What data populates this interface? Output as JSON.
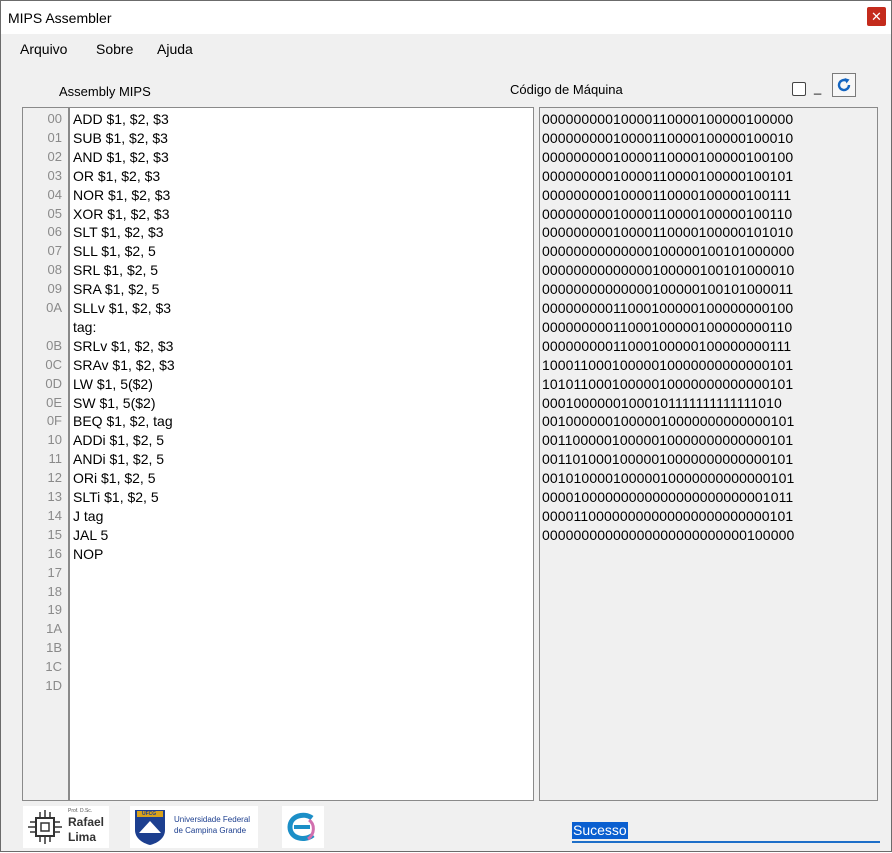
{
  "window": {
    "title": "MIPS Assembler",
    "close_label": "✕"
  },
  "menu": [
    "Arquivo",
    "Sobre",
    "Ajuda"
  ],
  "labels": {
    "assembly": "Assembly MIPS",
    "machine": "Código de Máquina",
    "dash": "_"
  },
  "line_numbers": [
    "00",
    "01",
    "02",
    "03",
    "04",
    "05",
    "06",
    "07",
    "08",
    "09",
    "0A",
    "",
    "0B",
    "0C",
    "0D",
    "0E",
    "0F",
    "10",
    "11",
    "12",
    "13",
    "14",
    "15",
    "16",
    "17",
    "18",
    "19",
    "1A",
    "1B",
    "1C",
    "1D"
  ],
  "code": [
    "ADD $1, $2, $3",
    "SUB $1, $2, $3",
    "AND $1, $2, $3",
    "OR $1, $2, $3",
    "NOR $1, $2, $3",
    "XOR $1, $2, $3",
    "SLT $1, $2, $3",
    "SLL $1, $2, 5",
    "SRL $1, $2, 5",
    "SRA $1, $2, 5",
    "SLLv $1, $2, $3",
    "tag:",
    "SRLv $1, $2, $3",
    "SRAv $1, $2, $3",
    "LW $1, 5($2)",
    "SW $1, 5($2)",
    "BEQ $1, $2, tag",
    "ADDi $1, $2, 5",
    "ANDi $1, $2, 5",
    "ORi $1, $2, 5",
    "SLTi $1, $2, 5",
    "J tag",
    "JAL 5",
    "NOP"
  ],
  "machine_code": [
    "00000000010000110000100000100000",
    "00000000010000110000100000100010",
    "00000000010000110000100000100100",
    "00000000010000110000100000100101",
    "00000000010000110000100000100111",
    "00000000010000110000100000100110",
    "00000000010000110000100000101010",
    "00000000000000100000100101000000",
    "00000000000000100000100101000010",
    "00000000000000100000100101000011",
    "00000000011000100000100000000100",
    "00000000011000100000100000000110",
    "00000000011000100000100000000111",
    "10001100010000010000000000000101",
    "10101100010000010000000000000101",
    "00010000001000101111111111111010",
    "00100000010000010000000000000101",
    "00110000010000010000000000000101",
    "00110100010000010000000000000101",
    "00101000010000010000000000000101",
    "00001000000000000000000000001011",
    "00001100000000000000000000000101",
    "00000000000000000000000000100000"
  ],
  "logos": {
    "rafael": {
      "small": "Prof. D.Sc.",
      "name1": "Rafael",
      "name2": "Lima"
    },
    "ufcg": {
      "abbr": "UFCG",
      "line1": "Universidade Federal",
      "line2": "de Campina Grande"
    }
  },
  "status": "Sucesso",
  "colors": {
    "accent": "#0a5fd0",
    "close": "#c42b1c",
    "refresh": "#1565c0"
  }
}
